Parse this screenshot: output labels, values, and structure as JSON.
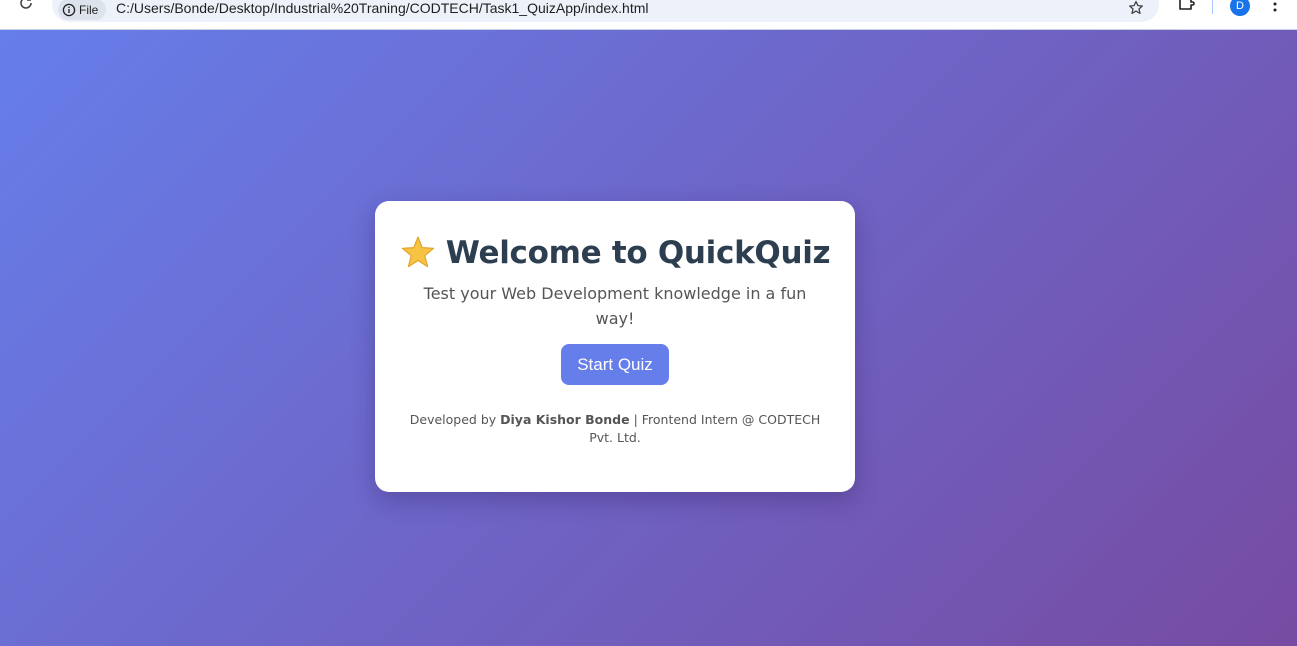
{
  "browser": {
    "site_info_label": "File",
    "url": "C:/Users/Bonde/Desktop/Industrial%20Traning/CODTECH/Task1_QuizApp/index.html",
    "profile_initial": "D",
    "icons": [
      "reload-icon",
      "info-icon",
      "star-icon",
      "extensions-icon",
      "kebab-menu-icon"
    ]
  },
  "page": {
    "title_emoji": "🌟",
    "title": "Welcome to QuickQuiz",
    "subtitle": "Test your Web Development knowledge in a fun way!",
    "start_button_label": "Start Quiz",
    "footer": {
      "prefix": "Developed by ",
      "author": "Diya Kishor Bonde",
      "suffix": " | Frontend Intern @ CODTECH Pvt. Ltd."
    }
  },
  "colors": {
    "gradient_start": "#667eea",
    "gradient_end": "#764ba2",
    "button": "#667eea",
    "title": "#2c3e50",
    "text": "#555555"
  }
}
